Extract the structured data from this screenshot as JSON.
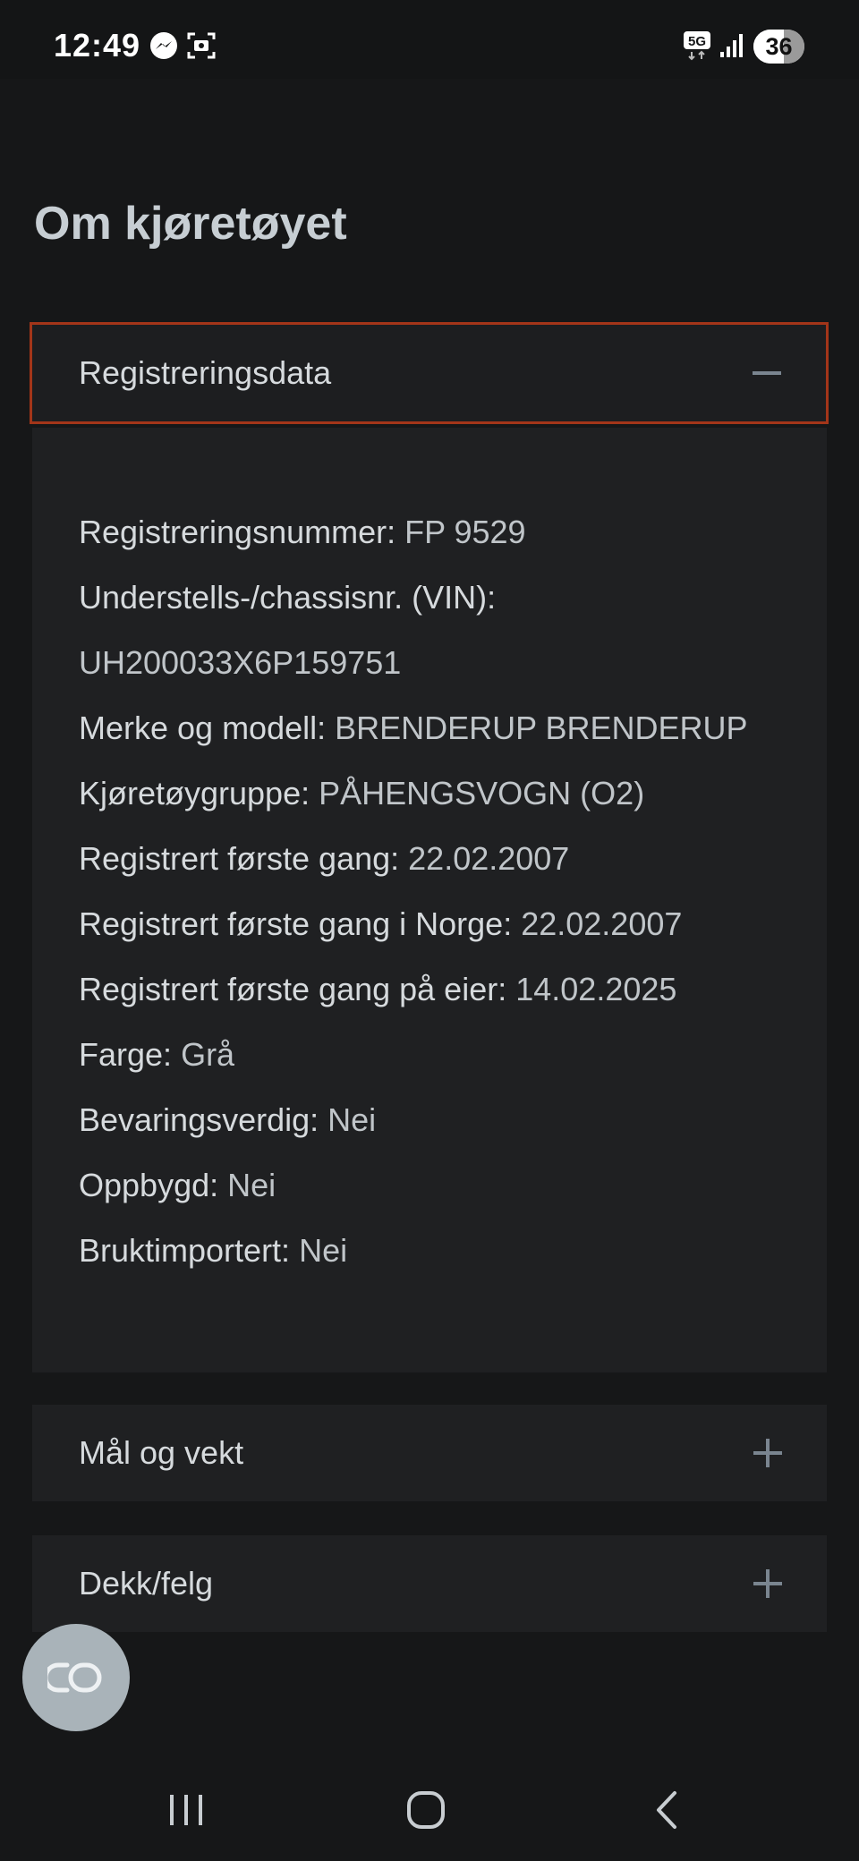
{
  "status_bar": {
    "time": "12:49",
    "network": "5G",
    "battery": "36",
    "icons": [
      "messenger-icon",
      "screenshot-icon",
      "5g-icon",
      "signal-icon",
      "battery-icon"
    ]
  },
  "page": {
    "title": "Om kjøretøyet"
  },
  "sections": {
    "registration": {
      "label": "Registreringsdata",
      "expanded": true,
      "rows": [
        {
          "key": "Registreringsnummer:",
          "value": "FP 9529"
        },
        {
          "key": "Understells-/chassisnr. (VIN):",
          "value": ""
        },
        {
          "key": "",
          "value": "UH200033X6P159751"
        },
        {
          "key": "Merke og modell:",
          "value": "BRENDERUP BRENDERUP"
        },
        {
          "key": "Kjøretøygruppe:",
          "value": "PÅHENGSVOGN (O2)"
        },
        {
          "key": "Registrert første gang:",
          "value": "22.02.2007"
        },
        {
          "key": "Registrert første gang i Norge:",
          "value": "22.02.2007"
        },
        {
          "key": "Registrert første gang på eier:",
          "value": "14.02.2025"
        },
        {
          "key": "Farge:",
          "value": "Grå"
        },
        {
          "key": "Bevaringsverdig:",
          "value": "Nei"
        },
        {
          "key": "Oppbygd:",
          "value": "Nei"
        },
        {
          "key": "Bruktimportert:",
          "value": "Nei"
        }
      ]
    },
    "dimensions": {
      "label": "Mål og vekt",
      "expanded": false
    },
    "tires": {
      "label": "Dekk/felg",
      "expanded": false
    }
  },
  "colors": {
    "background": "#161718",
    "card": "#1f2022",
    "focus_border": "#a33519",
    "fab": "#a9b3b9"
  }
}
